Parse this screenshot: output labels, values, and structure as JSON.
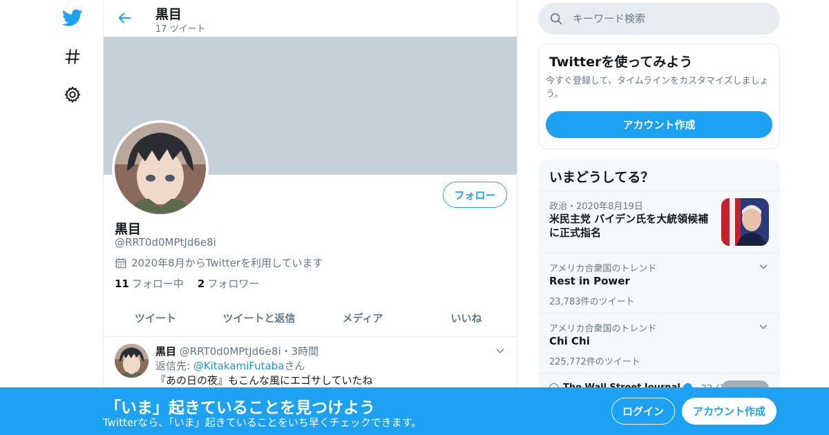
{
  "nav": {
    "icons": [
      "twitter-logo-icon",
      "hashtag-icon",
      "gear-icon"
    ]
  },
  "header": {
    "name": "黒目",
    "tweet_count": "17 ツイート"
  },
  "profile": {
    "follow_label": "フォロー",
    "name": "黒目",
    "handle": "@RRT0d0MPtJd6e8i",
    "joined": "2020年8月からTwitterを利用しています",
    "following_count": "11",
    "following_label": "フォロー中",
    "followers_count": "2",
    "followers_label": "フォロワー"
  },
  "tabs": [
    {
      "label": "ツイート"
    },
    {
      "label": "ツイートと返信"
    },
    {
      "label": "メディア"
    },
    {
      "label": "いいね"
    }
  ],
  "tweet": {
    "name": "黒目",
    "handle": "@RRT0d0MPtJd6e8i",
    "sep": "・",
    "time": "3時間",
    "reply_prefix": "返信先: ",
    "reply_handle": "@KitakamiFutaba",
    "reply_suffix": "さん",
    "text": "『あの日の夜』もこんな風にエゴサしていたね"
  },
  "search": {
    "placeholder": "キーワード検索"
  },
  "signup": {
    "title": "Twitterを使ってみよう",
    "description": "今すぐ登録して、タイムラインをカスタマイズしましょう。",
    "button": "アカウント作成"
  },
  "trends": {
    "title": "いまどうしてる？",
    "items": [
      {
        "context": "政治・2020年8月19日",
        "name": "米民主党 バイデン氏を大統領候補に正式指名",
        "count": ""
      },
      {
        "context": "アメリカ合衆国のトレンド",
        "name": "Rest in Power",
        "count": "23,783件のツイート"
      },
      {
        "context": "アメリカ合衆国のトレンド",
        "name": "Chi Chi",
        "count": "225,772件のツイート"
      },
      {
        "context": "The Wall Street Journal",
        "name": "",
        "count": "",
        "time": "・22 分前"
      }
    ]
  },
  "bottom_bar": {
    "title": "「いま」起きていることを見つけよう",
    "subtitle": "Twitterなら、「いま」起きていることをいち早くチェックできます。",
    "login": "ログイン",
    "signup": "アカウント作成"
  },
  "colors": {
    "accent": "#1da1f2",
    "banner": "#c5d0d9",
    "secondary_text": "#657786"
  }
}
